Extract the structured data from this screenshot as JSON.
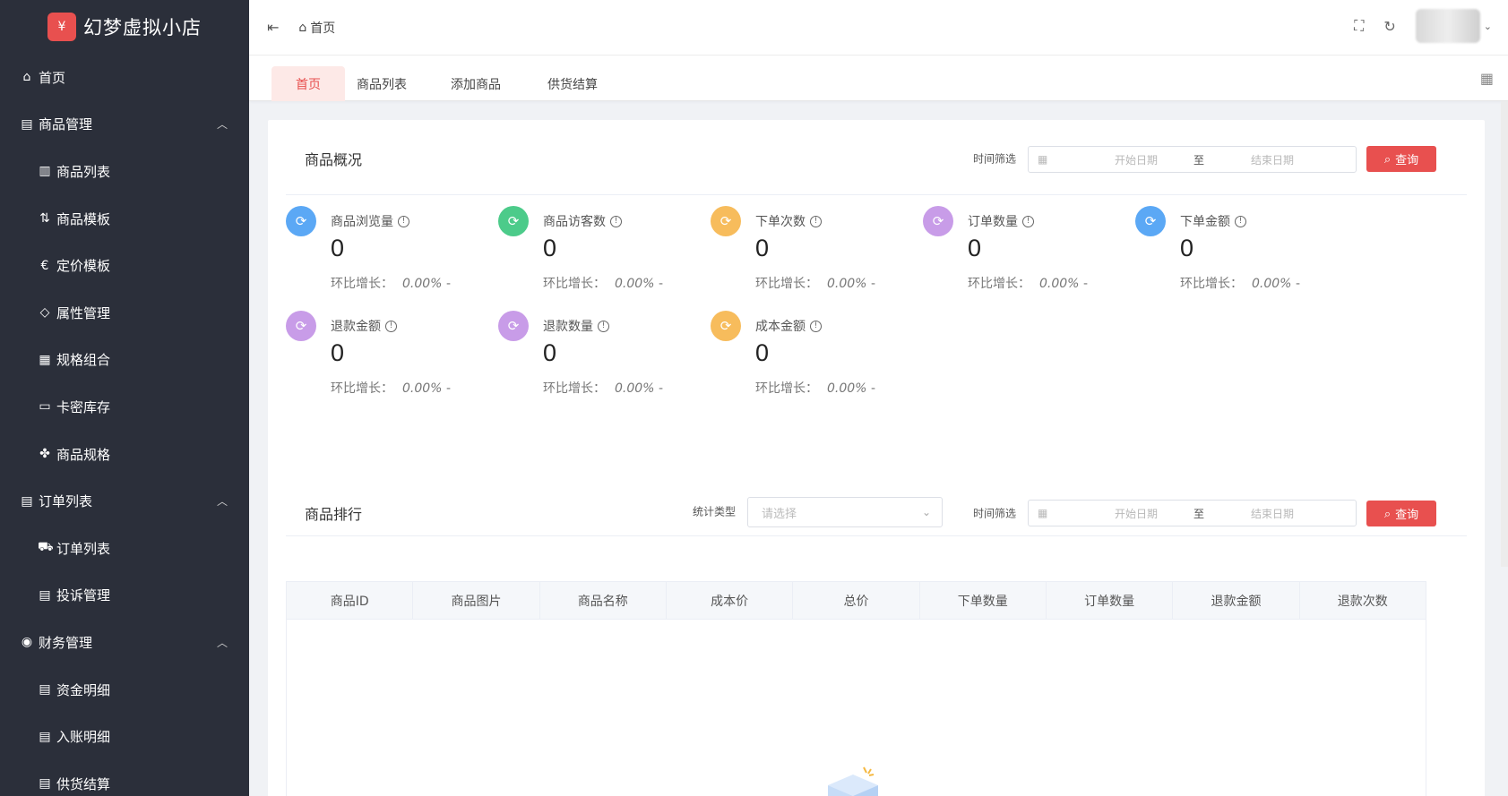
{
  "app": {
    "title": "幻梦虚拟小店",
    "logo_glyph": "¥",
    "brand_color": "#e8504f"
  },
  "sidebar": {
    "items": [
      {
        "label": "首页",
        "icon": "home-icon",
        "glyph": "⌂",
        "level": 1
      },
      {
        "label": "商品管理",
        "icon": "archive-icon",
        "glyph": "▤",
        "level": 1,
        "expanded": true
      },
      {
        "label": "商品列表",
        "icon": "document-icon",
        "glyph": "▥",
        "level": 2
      },
      {
        "label": "商品模板",
        "icon": "sort-icon",
        "glyph": "⇅",
        "level": 2
      },
      {
        "label": "定价模板",
        "icon": "price-icon",
        "glyph": "€",
        "level": 2
      },
      {
        "label": "属性管理",
        "icon": "tag-icon",
        "glyph": "◇",
        "level": 2
      },
      {
        "label": "规格组合",
        "icon": "grid-icon",
        "glyph": "▦",
        "level": 2
      },
      {
        "label": "卡密库存",
        "icon": "card-icon",
        "glyph": "▭",
        "level": 2
      },
      {
        "label": "商品规格",
        "icon": "cube-icon",
        "glyph": "✤",
        "level": 2
      },
      {
        "label": "订单列表",
        "icon": "order-icon",
        "glyph": "▤",
        "level": 1,
        "expanded": true
      },
      {
        "label": "订单列表",
        "icon": "cart-icon",
        "glyph": "⛟",
        "level": 2
      },
      {
        "label": "投诉管理",
        "icon": "document-icon",
        "glyph": "▤",
        "level": 2
      },
      {
        "label": "财务管理",
        "icon": "finance-icon",
        "glyph": "◉",
        "level": 1,
        "expanded": true
      },
      {
        "label": "资金明细",
        "icon": "document-icon",
        "glyph": "▤",
        "level": 2
      },
      {
        "label": "入账明细",
        "icon": "document-icon",
        "glyph": "▤",
        "level": 2
      },
      {
        "label": "供货结算",
        "icon": "document-icon",
        "glyph": "▤",
        "level": 2
      }
    ]
  },
  "header": {
    "breadcrumb": "首页"
  },
  "tabs": [
    {
      "label": "首页",
      "active": true
    },
    {
      "label": "商品列表",
      "active": false
    },
    {
      "label": "添加商品",
      "active": false
    },
    {
      "label": "供货结算",
      "active": false
    }
  ],
  "overview": {
    "title": "商品概况",
    "filter_label": "时间筛选",
    "start_placeholder": "开始日期",
    "separator": "至",
    "end_placeholder": "结束日期",
    "query_label": "查询",
    "growth_label": "环比增长：",
    "stats": [
      {
        "name": "商品浏览量",
        "value": "0",
        "growth": "0.00%",
        "trend": "-",
        "color": "#5ba8f5"
      },
      {
        "name": "商品访客数",
        "value": "0",
        "growth": "0.00%",
        "trend": "-",
        "color": "#4ccb8a"
      },
      {
        "name": "下单次数",
        "value": "0",
        "growth": "0.00%",
        "trend": "-",
        "color": "#f7bc5c"
      },
      {
        "name": "订单数量",
        "value": "0",
        "growth": "0.00%",
        "trend": "-",
        "color": "#c89ce8"
      },
      {
        "name": "下单金额",
        "value": "0",
        "growth": "0.00%",
        "trend": "-",
        "color": "#5ba8f5"
      },
      {
        "name": "退款金额",
        "value": "0",
        "growth": "0.00%",
        "trend": "-",
        "color": "#c89ce8"
      },
      {
        "name": "退款数量",
        "value": "0",
        "growth": "0.00%",
        "trend": "-",
        "color": "#c89ce8"
      },
      {
        "name": "成本金额",
        "value": "0",
        "growth": "0.00%",
        "trend": "-",
        "color": "#f7bc5c"
      }
    ]
  },
  "ranking": {
    "title": "商品排行",
    "type_label": "统计类型",
    "type_placeholder": "请选择",
    "filter_label": "时间筛选",
    "start_placeholder": "开始日期",
    "separator": "至",
    "end_placeholder": "结束日期",
    "query_label": "查询",
    "columns": [
      "商品ID",
      "商品图片",
      "商品名称",
      "成本价",
      "总价",
      "下单数量",
      "订单数量",
      "退款金额",
      "退款次数"
    ]
  }
}
